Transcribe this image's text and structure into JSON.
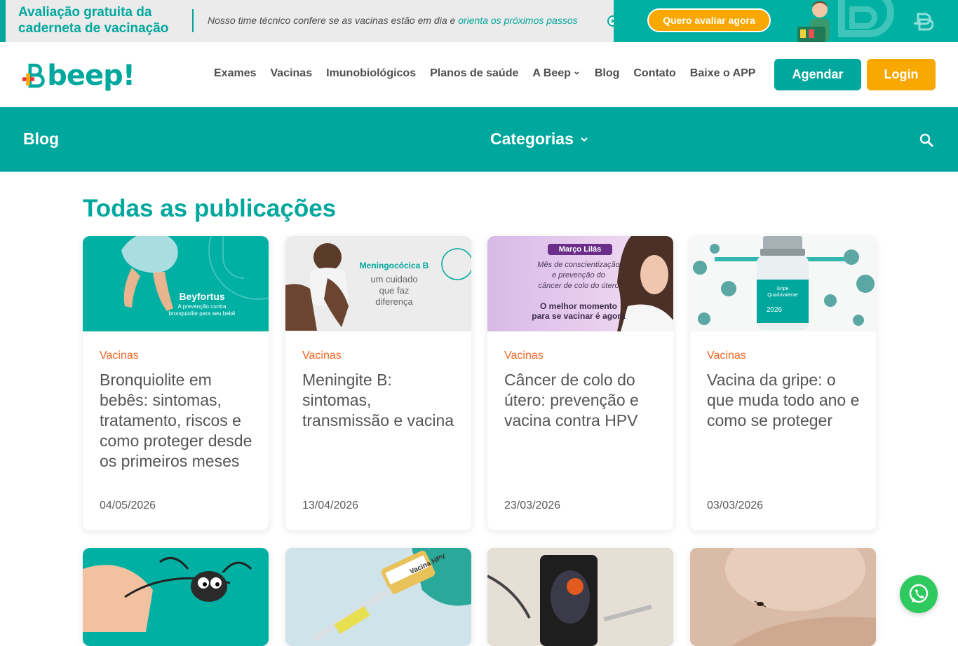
{
  "promo": {
    "title": "Avaliação gratuita da caderneta de vacinação",
    "text_prefix": "Nosso time técnico confere se as vacinas estão em dia e ",
    "text_highlight": "orienta os próximos passos",
    "cta_label": "Quero avaliar agora",
    "colors": {
      "teal": "#00a79d",
      "orange": "#f8a800"
    }
  },
  "header": {
    "logo_text": "beep!",
    "nav": [
      {
        "label": "Exames"
      },
      {
        "label": "Vacinas"
      },
      {
        "label": "Imunobiológicos"
      },
      {
        "label": "Planos de saúde"
      },
      {
        "label": "A Beep",
        "dropdown": true
      },
      {
        "label": "Blog"
      },
      {
        "label": "Contato"
      },
      {
        "label": "Baixe o APP"
      }
    ],
    "agendar_label": "Agendar",
    "login_label": "Login"
  },
  "blogbar": {
    "title": "Blog",
    "categories_label": "Categorias",
    "search_icon": "search-icon"
  },
  "main": {
    "heading": "Todas as publicações",
    "posts": [
      {
        "category": "Vacinas",
        "title": "Bronquiolite em bebês: sintomas, tratamento, riscos e como proteger desde os primeiros meses",
        "date": "04/05/2026",
        "image_text": {
          "title": "Beyfortus",
          "line1": "A prevenção contra",
          "line2": "bronquiolite para seu bebê"
        }
      },
      {
        "category": "Vacinas",
        "title": "Meningite B: sintomas, transmissão e vacina",
        "date": "13/04/2026",
        "image_text": {
          "title": "Meningocócica B",
          "line1": "um cuidado",
          "line2": "que faz",
          "line3": "diferença"
        }
      },
      {
        "category": "Vacinas",
        "title": "Câncer de colo do útero: prevenção e vacina contra HPV",
        "date": "23/03/2026",
        "image_text": {
          "badge": "Março Lilás",
          "line1": "Mês de conscientização",
          "line2": "e prevenção do",
          "line3": "câncer de colo do útero",
          "bold1": "O melhor momento",
          "bold2": "para se vacinar é agora"
        }
      },
      {
        "category": "Vacinas",
        "title": "Vacina da gripe: o que muda todo ano e como se proteger",
        "date": "03/03/2026",
        "image_text": {
          "label1": "Gripe",
          "label2": "Quadrivalente",
          "year": "2026"
        }
      }
    ],
    "second_row_images": [
      {
        "image_text": ""
      },
      {
        "image_text": "Vacina HPV"
      },
      {
        "image_text": ""
      },
      {
        "image_text": ""
      }
    ]
  },
  "whatsapp": {
    "icon": "whatsapp-icon",
    "color": "#2fca5f"
  }
}
